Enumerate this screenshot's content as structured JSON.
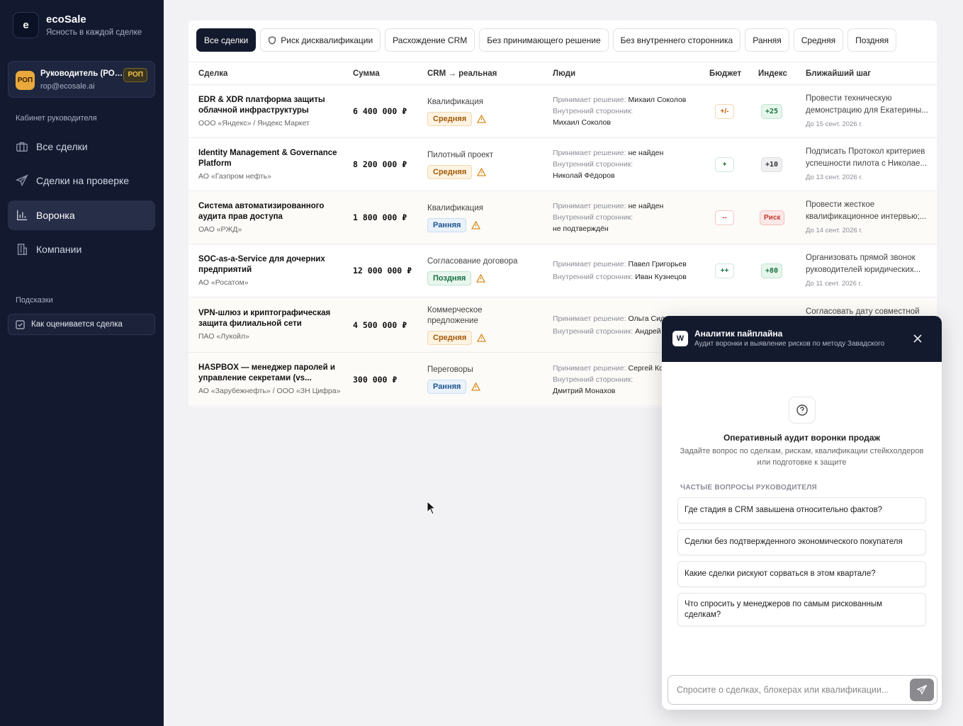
{
  "app": {
    "logo_letter": "e",
    "name": "ecoSale",
    "tagline": "Ясность в каждой сделке"
  },
  "user": {
    "avatar": "РОП",
    "name": "Руководитель (РОП ...",
    "email": "rop@ecosale.ai",
    "badge": "РОП"
  },
  "sidebar": {
    "section_label": "Кабинет руководителя",
    "items": [
      {
        "label": "Все сделки",
        "icon": "briefcase-icon"
      },
      {
        "label": "Сделки на проверке",
        "icon": "send-icon"
      },
      {
        "label": "Воронка",
        "icon": "bar-chart-icon",
        "active": true
      },
      {
        "label": "Компании",
        "icon": "building-icon"
      }
    ],
    "hints_label": "Подсказки",
    "hint_item": "Как оценивается сделка"
  },
  "filters": [
    "Все сделки",
    "Риск дисквалификации",
    "Расхождение CRM",
    "Без принимающего решение",
    "Без внутреннего сторонника",
    "Ранняя",
    "Средняя",
    "Поздняя"
  ],
  "table": {
    "headers": {
      "deal": "Сделка",
      "amount": "Сумма",
      "crm": "CRM → реальная",
      "people": "Люди",
      "budget": "Бюджет",
      "index": "Индекс",
      "next": "Ближайший шаг"
    },
    "rows": [
      {
        "name": "EDR & XDR платформа защиты облачной инфраструктуры",
        "company": "ООО «Яндекс» / Яндекс Маркет",
        "amount": "6 400 000 ₽",
        "crm_stage": "Квалификация",
        "stage": "Средняя",
        "dm_label": "Принимает решение:",
        "dm": "Михаил Соколов",
        "champ_label": "Внутренний сторонник:",
        "champ": "Михаил Соколов",
        "budget": "+/-",
        "index": "+25",
        "next": "Провести техническую демонстрацию для Екатерины...",
        "date": "До 15 сент. 2026 г."
      },
      {
        "name": "Identity Management & Governance Platform",
        "company": "АО «Газпром нефть»",
        "amount": "8 200 000 ₽",
        "crm_stage": "Пилотный проект",
        "stage": "Средняя",
        "dm_label": "Принимает решение:",
        "dm": "не найден",
        "champ_label": "Внутренний сторонник:",
        "champ": "Николай Фёдоров",
        "budget": "+",
        "index": "+10",
        "next": "Подписать Протокол критериев успешности пилота с Николае...",
        "date": "До 13 сент. 2026 г."
      },
      {
        "name": "Система автоматизированного аудита прав доступа",
        "company": "ОАО «РЖД»",
        "amount": "1 800 000 ₽",
        "crm_stage": "Квалификация",
        "stage": "Ранняя",
        "dm_label": "Принимает решение:",
        "dm": "не найден",
        "champ_label": "Внутренний сторонник:",
        "champ": "не подтверждён",
        "budget": "--",
        "index": "Риск",
        "next": "Провести жесткое квалификационное интервью;...",
        "date": "До 14 сент. 2026 г."
      },
      {
        "name": "SOC-as-a-Service для дочерних предприятий",
        "company": "АО «Росатом»",
        "amount": "12 000 000 ₽",
        "crm_stage": "Согласование договора",
        "stage": "Поздняя",
        "dm_label": "Принимает решение:",
        "dm": "Павел Григорьев",
        "champ_label": "Внутренний сторонник:",
        "champ": "Иван Кузнецов",
        "budget": "++",
        "index": "+80",
        "next": "Организовать прямой звонок руководителей юридических...",
        "date": "До 11 сент. 2026 г."
      },
      {
        "name": "VPN-шлюз и криптографическая защита филиальной сети",
        "company": "ПАО «Лукойл»",
        "amount": "4 500 000 ₽",
        "crm_stage": "Коммерческое предложение",
        "stage": "Средняя",
        "dm_label": "Принимает решение:",
        "dm": "Ольга Сид",
        "champ_label": "Внутренний сторонник:",
        "champ": "Андрей",
        "next": "Согласовать дату совместной"
      },
      {
        "name": "HASPBOX — менеджер паролей и управление секретами (vs...",
        "company": "АО «Зарубежнефть» / ООО «ЗН Цифра»",
        "amount": "300 000 ₽",
        "crm_stage": "Переговоры",
        "stage": "Ранняя",
        "dm_label": "Принимает решение:",
        "dm": "Сергей Ко",
        "champ_label": "Внутренний сторонник:",
        "champ": "Дмитрий Монахов"
      }
    ]
  },
  "assistant": {
    "logo": "W",
    "title": "Аналитик пайплайна",
    "subtitle": "Аудит воронки и выявление рисков по методу Завадского",
    "heading": "Оперативный аудит воронки продаж",
    "description": "Задайте вопрос по сделкам, рискам, квалификации стейкхолдеров или подготовке к защите",
    "faq_label": "ЧАСТЫЕ ВОПРОСЫ РУКОВОДИТЕЛЯ",
    "questions": [
      "Где стадия в CRM завышена относительно фактов?",
      "Сделки без подтвержденного экономического покупателя",
      "Какие сделки рискуют сорваться в этом квартале?",
      "Что спросить у менеджеров по самым рискованным сделкам?"
    ],
    "input_placeholder": "Спросите о сделках, блокерах или квалификации..."
  }
}
